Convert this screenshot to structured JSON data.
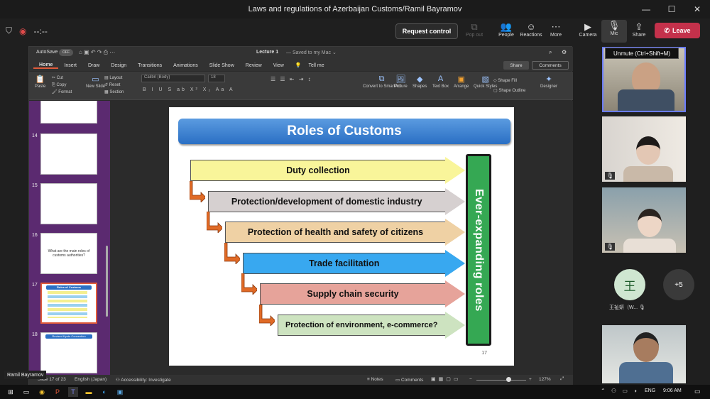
{
  "window": {
    "title": "Laws and regulations of Azerbaijan Customs/Ramil Bayramov"
  },
  "toolbar": {
    "timer": "--:--",
    "request_control": "Request control",
    "pop_out": "Pop out",
    "people": "People",
    "reactions": "Reactions",
    "more": "More",
    "camera": "Camera",
    "mic": "Mic",
    "share": "Share",
    "leave": "Leave",
    "tooltip": "Unmute (Ctrl+Shift+M)"
  },
  "ppt": {
    "autosave": "AutoSave",
    "autosave_state": "OFF",
    "doc_title": "Lecture 1",
    "doc_status": "— Saved to my Mac ⌄",
    "tabs": [
      "Home",
      "Insert",
      "Draw",
      "Design",
      "Transitions",
      "Animations",
      "Slide Show",
      "Review",
      "View",
      "Tell me"
    ],
    "share": "Share",
    "comments": "Comments",
    "ribbon": {
      "paste": "Paste",
      "cut": "Cut",
      "copy": "Copy",
      "format": "Format",
      "new_slide": "New Slide",
      "layout": "Layout",
      "reset": "Reset",
      "section": "Section",
      "font": "Calibri (Body)",
      "size": "18",
      "convert": "Convert to SmartArt",
      "picture": "Picture",
      "shapes": "Shapes",
      "textbox": "Text Box",
      "arrange": "Arrange",
      "quick_styles": "Quick Styles",
      "shape_fill": "Shape Fill",
      "shape_outline": "Shape Outline",
      "designer": "Designer"
    },
    "thumbs": [
      {
        "num": "14",
        "text": ""
      },
      {
        "num": "15",
        "text": ""
      },
      {
        "num": "16",
        "text": "What are the main roles of customs authorities?"
      },
      {
        "num": "17",
        "text": "Roles of Customs"
      },
      {
        "num": "18",
        "text": "Revised Kyoto Convention"
      }
    ],
    "status": {
      "slide": "Slide 17 of 23",
      "lang": "English (Japan)",
      "access": "Accessibility: Investigate",
      "notes": "Notes",
      "comments": "Comments",
      "zoom": "127%"
    }
  },
  "slide": {
    "title": "Roles of Customs",
    "roles": [
      {
        "label": "Duty collection",
        "color": "#f9f59a"
      },
      {
        "label": "Protection/development of domestic industry",
        "color": "#d6d0d0"
      },
      {
        "label": "Protection of health and safety of citizens",
        "color": "#efd1a4"
      },
      {
        "label": "Trade facilitation",
        "color": "#38a8f0"
      },
      {
        "label": "Supply chain security",
        "color": "#e6a39a"
      },
      {
        "label": "Protection of environment, e-commerce?",
        "color": "#cde3c0"
      }
    ],
    "side_label": "Ever-expanding roles",
    "page": "17"
  },
  "participants": {
    "presenter": "Ramil Bayramov",
    "avatar_initial": "王",
    "avatar_name": "王祉妍（W...",
    "more_count": "+5"
  },
  "taskbar": {
    "lang": "ENG",
    "time": "9:06 AM"
  }
}
